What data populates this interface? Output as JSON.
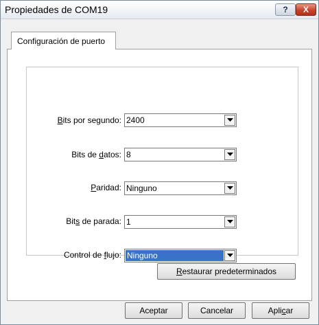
{
  "window": {
    "title": "Propiedades de COM19",
    "help_button": "?",
    "close_button": "X"
  },
  "tabs": [
    {
      "label": "Configuración de puerto",
      "selected": true
    }
  ],
  "fields": [
    {
      "label_pre": "",
      "label_key": "B",
      "label_post": "its por segundo:",
      "value": "2400",
      "focused": false
    },
    {
      "label_pre": "Bits de ",
      "label_key": "d",
      "label_post": "atos:",
      "value": "8",
      "focused": false
    },
    {
      "label_pre": "",
      "label_key": "P",
      "label_post": "aridad:",
      "value": "Ninguno",
      "focused": false
    },
    {
      "label_pre": "Bit",
      "label_key": "s",
      "label_post": " de parada:",
      "value": "1",
      "focused": false
    },
    {
      "label_pre": "Control de ",
      "label_key": "f",
      "label_post": "lujo:",
      "value": "Ninguno",
      "focused": true
    }
  ],
  "restore_button": {
    "key": "R",
    "rest": "estaurar predeterminados"
  },
  "footer": {
    "ok": "Aceptar",
    "cancel": "Cancelar",
    "apply_pre": "Apli",
    "apply_key": "c",
    "apply_post": "ar"
  },
  "colors": {
    "selection": "#3a71c9",
    "close_button": "#c9432a"
  }
}
